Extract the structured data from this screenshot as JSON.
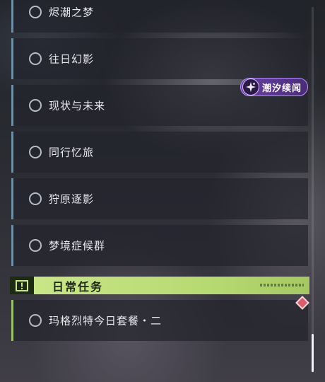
{
  "quests": [
    {
      "label": "烬潮之梦"
    },
    {
      "label": "往日幻影"
    },
    {
      "label": "现状与未来"
    },
    {
      "label": "同行忆旅"
    },
    {
      "label": "狩原逐影"
    },
    {
      "label": "梦境症候群"
    }
  ],
  "badge": {
    "label": "潮汐续闻",
    "icon": "sparkle-icon",
    "color": "#6a3fa6"
  },
  "daily_section": {
    "title": "日常任务",
    "icon": "exclamation-icon",
    "accent": "#cbe889",
    "items": [
      {
        "label": "玛格烈特今日套餐・二"
      }
    ]
  },
  "colors": {
    "quest_border": "#6f8ea6",
    "daily_border": "#9cc06a",
    "alert": "#e35a6a"
  }
}
